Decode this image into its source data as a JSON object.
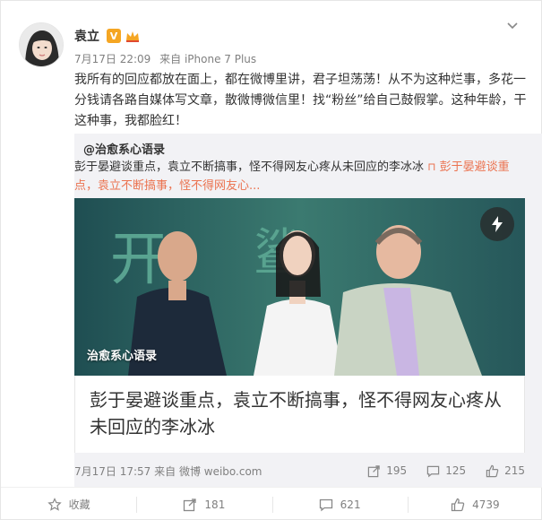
{
  "post": {
    "user_name": "袁立",
    "verified_badge": "V",
    "time": "7月17日 22:09",
    "source": "来自 iPhone 7 Plus",
    "text": "我所有的回应都放在面上，都在微博里讲，君子坦荡荡！从不为这种烂事，多花一分钱请各路自媒体写文章，散微博微信里！找“粉丝”给自己鼓假掌。这种年龄，干这种事，我都脸红！"
  },
  "repost": {
    "author": "@治愈系心语录",
    "text": "彭于晏避谈重点，袁立不断搞事，怪不得网友心疼从未回应的李冰冰",
    "link_glyph": "⊓",
    "link_text": "彭于晏避谈重点，袁立不断搞事，怪不得网友心...",
    "media_label": "治愈系心语录",
    "article_title": "彭于晏避谈重点，袁立不断搞事，怪不得网友心疼从未回应的李冰冰",
    "footer": {
      "time": "7月17日 17:57",
      "source": "来自 微博 weibo.com",
      "reposts": "195",
      "comments": "125",
      "likes": "215"
    }
  },
  "actions": {
    "favorite": "收藏",
    "repost": "181",
    "comment": "621",
    "like": "4739"
  },
  "colors": {
    "link": "#eb7350",
    "meta": "#808080",
    "quote_bg": "#f2f2f5"
  }
}
